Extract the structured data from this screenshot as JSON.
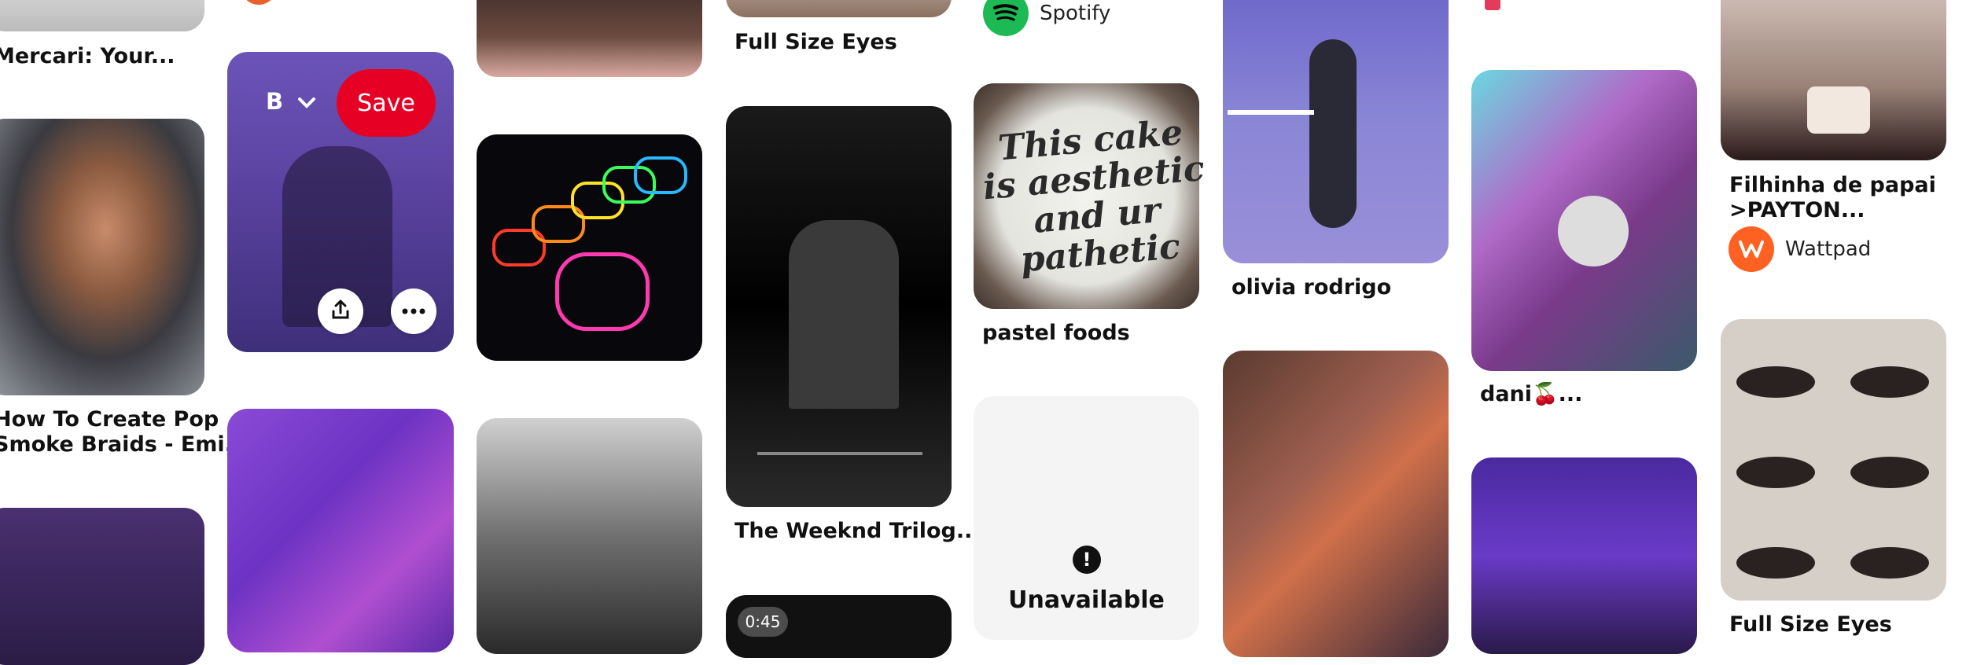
{
  "pins": {
    "mercari_title": "Mercari: Your...",
    "braids_title_line1": "How To Create Pop",
    "braids_title_line2": "Smoke Braids - Emi...",
    "full_size_eyes_top": "Full Size Eyes",
    "weeknd_title": "The Weeknd Trilog...",
    "pastel_title": "pastel foods",
    "olivia_title": "olivia rodrigo",
    "dani_title": "dani🍒...",
    "filhinha_line1": "Filhinha de papai",
    "filhinha_line2": ">PAYTON...",
    "full_size_eyes_bottom": "Full Size Eyes",
    "cake_text": "This cake is aesthetic and ur pathetic",
    "video_duration": "0:45"
  },
  "sources": {
    "spotify": "Spotify",
    "wattpad": "Wattpad"
  },
  "hover_pin": {
    "board_label": "B",
    "save_label": "Save"
  },
  "unavailable": {
    "label": "Unavailable"
  },
  "colors": {
    "save_red": "#e60023",
    "spotify_green": "#1db954",
    "wattpad_orange": "#ff6122"
  },
  "icons": [
    "chevron-down-icon",
    "share-icon",
    "more-icon",
    "spotify-icon",
    "wattpad-icon",
    "alert-icon",
    "heart-icon"
  ]
}
